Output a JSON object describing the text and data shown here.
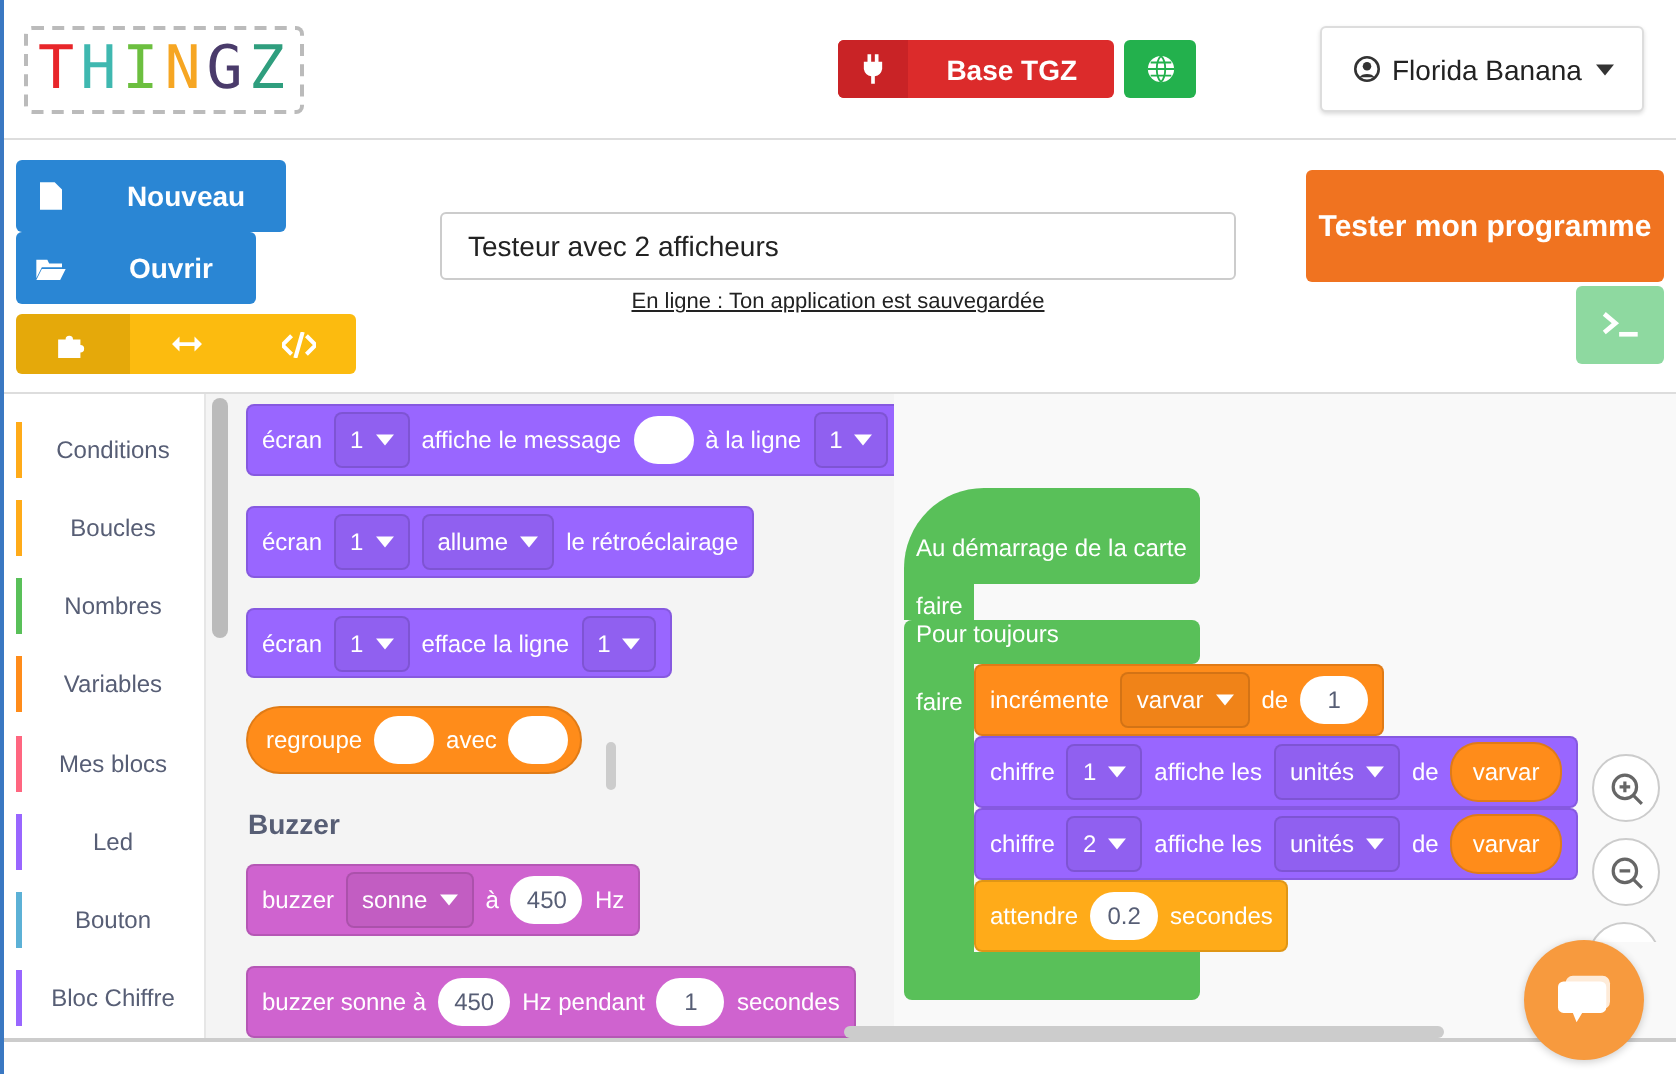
{
  "header": {
    "logo": "THINGZ",
    "connection_button": {
      "label": "Base TGZ"
    },
    "user_menu": {
      "name": "Florida Banana"
    }
  },
  "file_buttons": [
    {
      "kind": "new",
      "label": "Nouveau"
    },
    {
      "kind": "open",
      "label": "Ouvrir"
    }
  ],
  "view_tabs": [
    {
      "kind": "blocks",
      "selected": true
    },
    {
      "kind": "split",
      "selected": false
    },
    {
      "kind": "code",
      "selected": false
    }
  ],
  "project_name": {
    "value": "Testeur avec 2 afficheurs"
  },
  "save_status": "En ligne : Ton application est sauvegardée",
  "run_button": {
    "label": "Tester mon programme"
  },
  "categories": [
    {
      "label": "Conditions",
      "color": "#ffab19"
    },
    {
      "label": "Boucles",
      "color": "#ffab19"
    },
    {
      "label": "Nombres",
      "color": "#59c059"
    },
    {
      "label": "Variables",
      "color": "#ff8c1a"
    },
    {
      "label": "Mes blocs",
      "color": "#ff6680"
    },
    {
      "label": "Led",
      "color": "#9966ff"
    },
    {
      "label": "Bouton",
      "color": "#5cb1d6"
    },
    {
      "label": "Bloc Chiffre",
      "color": "#9966ff"
    }
  ],
  "flyout": [
    {
      "kind": "stack",
      "color": "#9966ff",
      "parts": [
        {
          "kind": "label",
          "text": "écran"
        },
        {
          "kind": "dropdown",
          "text": "1"
        },
        {
          "kind": "label",
          "text": "affiche le message"
        },
        {
          "kind": "slot"
        },
        {
          "kind": "label",
          "text": "à la ligne"
        },
        {
          "kind": "dropdown",
          "text": "1"
        }
      ]
    },
    {
      "kind": "stack",
      "color": "#9966ff",
      "parts": [
        {
          "kind": "label",
          "text": "écran"
        },
        {
          "kind": "dropdown",
          "text": "1"
        },
        {
          "kind": "dropdown",
          "text": "allume"
        },
        {
          "kind": "label",
          "text": "le rétroéclairage"
        }
      ]
    },
    {
      "kind": "stack",
      "color": "#9966ff",
      "parts": [
        {
          "kind": "label",
          "text": "écran"
        },
        {
          "kind": "dropdown",
          "text": "1"
        },
        {
          "kind": "label",
          "text": "efface la ligne"
        },
        {
          "kind": "dropdown",
          "text": "1"
        }
      ]
    },
    {
      "kind": "reporter",
      "color": "#ff8c1a",
      "parts": [
        {
          "kind": "label",
          "text": "regroupe"
        },
        {
          "kind": "slot"
        },
        {
          "kind": "label",
          "text": "avec"
        },
        {
          "kind": "slot"
        }
      ]
    },
    {
      "kind": "heading",
      "text": "Buzzer"
    },
    {
      "kind": "stack",
      "color": "#cf63cf",
      "parts": [
        {
          "kind": "label",
          "text": "buzzer"
        },
        {
          "kind": "dropdown",
          "text": "sonne"
        },
        {
          "kind": "label",
          "text": "à"
        },
        {
          "kind": "input",
          "text": "450"
        },
        {
          "kind": "label",
          "text": "Hz"
        }
      ]
    },
    {
      "kind": "stack",
      "color": "#cf63cf",
      "parts": [
        {
          "kind": "label",
          "text": "buzzer sonne à"
        },
        {
          "kind": "input",
          "text": "450"
        },
        {
          "kind": "label",
          "text": "Hz pendant"
        },
        {
          "kind": "input",
          "text": "1"
        },
        {
          "kind": "label",
          "text": "secondes"
        }
      ]
    }
  ],
  "script": [
    {
      "kind": "hat",
      "color": "#59c059",
      "header": "Au démarrage de la carte",
      "arm": "faire"
    },
    {
      "kind": "loop",
      "color": "#59c059",
      "header": "Pour toujours",
      "arm": "faire",
      "children": [
        {
          "kind": "stack",
          "color": "#ff8c1a",
          "parts": [
            {
              "kind": "label",
              "text": "incrémente"
            },
            {
              "kind": "dropdown",
              "text": "varvar"
            },
            {
              "kind": "label",
              "text": "de"
            },
            {
              "kind": "input",
              "text": "1"
            }
          ]
        },
        {
          "kind": "stack",
          "color": "#9966ff",
          "parts": [
            {
              "kind": "label",
              "text": "chiffre"
            },
            {
              "kind": "dropdown",
              "text": "1"
            },
            {
              "kind": "label",
              "text": "affiche les"
            },
            {
              "kind": "dropdown",
              "text": "unités"
            },
            {
              "kind": "label",
              "text": "de"
            },
            {
              "kind": "variable",
              "text": "varvar"
            }
          ]
        },
        {
          "kind": "stack",
          "color": "#9966ff",
          "parts": [
            {
              "kind": "label",
              "text": "chiffre"
            },
            {
              "kind": "dropdown",
              "text": "2"
            },
            {
              "kind": "label",
              "text": "affiche les"
            },
            {
              "kind": "dropdown",
              "text": "unités"
            },
            {
              "kind": "label",
              "text": "de"
            },
            {
              "kind": "variable",
              "text": "varvar"
            }
          ]
        },
        {
          "kind": "stack",
          "color": "#ffab19",
          "parts": [
            {
              "kind": "label",
              "text": "attendre"
            },
            {
              "kind": "input",
              "text": "0.2"
            },
            {
              "kind": "label",
              "text": "secondes"
            }
          ]
        }
      ]
    }
  ]
}
